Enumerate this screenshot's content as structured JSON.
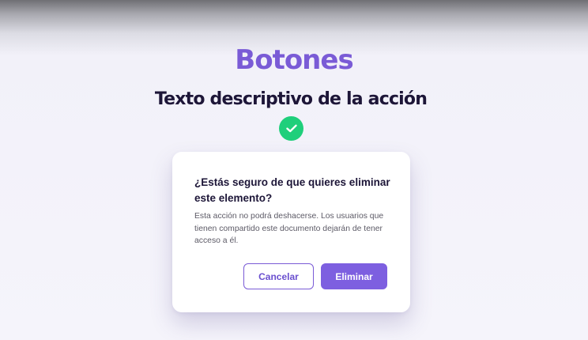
{
  "page": {
    "title": "Botones",
    "subtitle": "Texto descriptivo de la acción",
    "status_icon": "check-circle-icon"
  },
  "dialog": {
    "title": "¿Estás seguro de que quieres eliminar este elemento?",
    "body": "Esta acción no podrá deshacerse. Los usuarios que tienen compartido este documento dejarán de tener acceso a él.",
    "cancel_label": "Cancelar",
    "confirm_label": "Eliminar"
  },
  "colors": {
    "accent": "#7a5bd6",
    "primary_button": "#7d5fe0",
    "success": "#1fcf7b",
    "heading": "#1d1638",
    "body_text": "#5c5a66",
    "background": "#f5f4fb"
  }
}
